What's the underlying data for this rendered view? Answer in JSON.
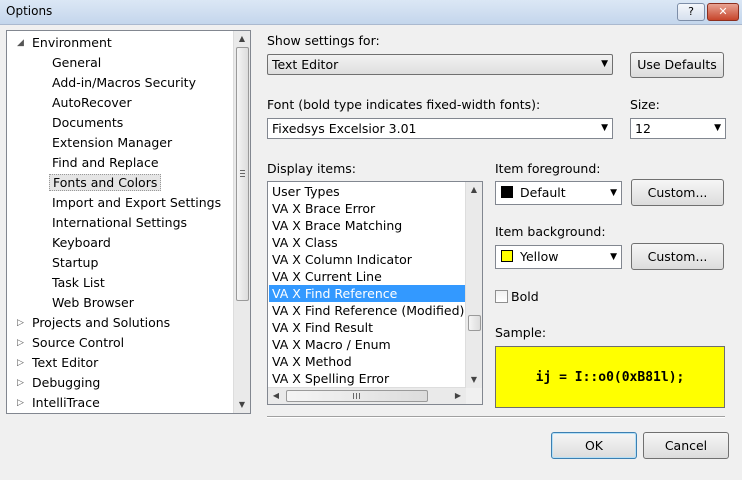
{
  "window": {
    "title": "Options",
    "help_label": "?",
    "close_label": "✕"
  },
  "tree": {
    "items": [
      {
        "label": "Environment",
        "level": 0,
        "expander": "◢",
        "selected": false
      },
      {
        "label": "General",
        "level": 1,
        "selected": false
      },
      {
        "label": "Add-in/Macros Security",
        "level": 1,
        "selected": false
      },
      {
        "label": "AutoRecover",
        "level": 1,
        "selected": false
      },
      {
        "label": "Documents",
        "level": 1,
        "selected": false
      },
      {
        "label": "Extension Manager",
        "level": 1,
        "selected": false
      },
      {
        "label": "Find and Replace",
        "level": 1,
        "selected": false
      },
      {
        "label": "Fonts and Colors",
        "level": 1,
        "selected": true
      },
      {
        "label": "Import and Export Settings",
        "level": 1,
        "selected": false
      },
      {
        "label": "International Settings",
        "level": 1,
        "selected": false
      },
      {
        "label": "Keyboard",
        "level": 1,
        "selected": false
      },
      {
        "label": "Startup",
        "level": 1,
        "selected": false
      },
      {
        "label": "Task List",
        "level": 1,
        "selected": false
      },
      {
        "label": "Web Browser",
        "level": 1,
        "selected": false
      },
      {
        "label": "Projects and Solutions",
        "level": 0,
        "expander": "▷",
        "selected": false
      },
      {
        "label": "Source Control",
        "level": 0,
        "expander": "▷",
        "selected": false
      },
      {
        "label": "Text Editor",
        "level": 0,
        "expander": "▷",
        "selected": false
      },
      {
        "label": "Debugging",
        "level": 0,
        "expander": "▷",
        "selected": false
      },
      {
        "label": "IntelliTrace",
        "level": 0,
        "expander": "▷",
        "selected": false
      }
    ]
  },
  "settings": {
    "show_settings_label": "Show settings for:",
    "show_settings_value": "Text Editor",
    "use_defaults_label": "Use Defaults",
    "font_label": "Font (bold type indicates fixed-width fonts):",
    "font_value": "Fixedsys Excelsior 3.01",
    "size_label": "Size:",
    "size_value": "12"
  },
  "display_items": {
    "label": "Display items:",
    "items": [
      {
        "label": "User Types",
        "selected": false
      },
      {
        "label": "VA X Brace Error",
        "selected": false
      },
      {
        "label": "VA X Brace Matching",
        "selected": false
      },
      {
        "label": "VA X Class",
        "selected": false
      },
      {
        "label": "VA X Column Indicator",
        "selected": false
      },
      {
        "label": "VA X Current Line",
        "selected": false
      },
      {
        "label": "VA X Find Reference",
        "selected": true
      },
      {
        "label": "VA X Find Reference (Modified)",
        "selected": false
      },
      {
        "label": "VA X Find Result",
        "selected": false
      },
      {
        "label": "VA X Macro / Enum",
        "selected": false
      },
      {
        "label": "VA X Method",
        "selected": false
      },
      {
        "label": "VA X Spelling Error",
        "selected": false
      }
    ]
  },
  "foreground": {
    "label": "Item foreground:",
    "value": "Default",
    "color": "#000000",
    "custom_label": "Custom..."
  },
  "background": {
    "label": "Item background:",
    "value": "Yellow",
    "color": "#ffff00",
    "custom_label": "Custom..."
  },
  "bold": {
    "label": "Bold",
    "checked": false
  },
  "sample": {
    "label": "Sample:",
    "text": "ij = I::o0(0xB81l);",
    "background": "#ffff00"
  },
  "footer": {
    "ok_label": "OK",
    "cancel_label": "Cancel"
  },
  "icons": {
    "dropdown": "▼",
    "scroll_up": "▲",
    "scroll_down": "▼",
    "scroll_left": "◀",
    "scroll_right": "▶"
  }
}
